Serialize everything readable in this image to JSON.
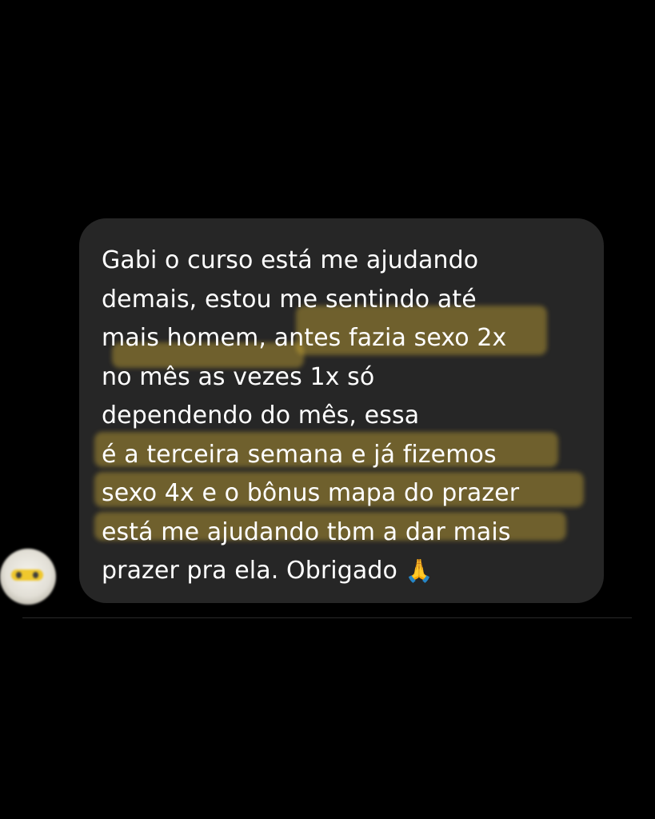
{
  "conversation": {
    "message": {
      "lines": [
        "Gabi o curso está me ajudando",
        "demais, estou me sentindo até",
        "mais homem, antes fazia sexo 2x",
        "no mês as vezes 1x só",
        "dependendo do mês, essa",
        "é a terceira semana e já fizemos",
        "sexo 4x e o bônus mapa do prazer",
        "está me ajudando tbm a dar mais",
        "prazer pra ela. Obrigado"
      ],
      "emoji": "🙏"
    },
    "avatar_icon": "blurred-profile-avatar",
    "colors": {
      "background": "#000000",
      "bubble": "#262626",
      "text": "#ffffff",
      "highlight": "#d4b036"
    }
  }
}
